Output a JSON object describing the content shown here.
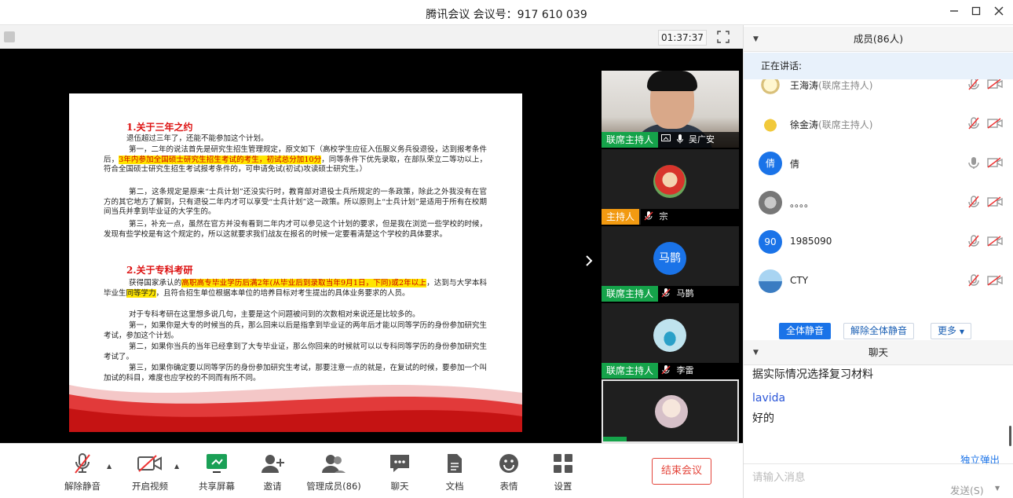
{
  "window": {
    "title": "腾讯会议 会议号：917 610 039",
    "controls": [
      "minimize-icon",
      "maximize-icon",
      "close-icon"
    ]
  },
  "stage": {
    "timer": "01:37:37",
    "slide": {
      "heading1": "1.关于三年之约",
      "p1": "退伍超过三年了，还能不能参加这个计划。",
      "p2a": "第一，二年的说法首先是研究生招生管理规定，原文如下（高校学生应征入伍服义务兵役退役，达到报考条件后，",
      "p2hl": "3年内参加全国硕士研究生招生考试的考生，初试总分加10分",
      "p2b": "，同等条件下优先录取，在部队荣立二等功以上，符合全国硕士研究生招生考试报考条件的，可申请免试(初试)攻读硕士研究生。）",
      "p3": "第二，这条规定是原来“士兵计划”还没实行时，教育部对退役士兵所规定的一条政策，除此之外我没有在官方的其它地方了解到，只有退役二年内才可以享受“士兵计划”这一政策。所以原则上“士兵计划”是适用于所有在校期间当兵并拿到毕业证的大学生的。",
      "p4": "第三，补充一点，虽然在官方并没有看到二年内才可以参见这个计划的要求，但是我在浏览一些学校的时候，发现有些学校是有这个规定的，所以这就要求我们战友在报名的时候一定要看清楚这个学校的具体要求。",
      "heading2": "2.关于专科考研",
      "p5a": "获得国家承认的",
      "p5hl": "高职高专毕业学历后满2年(从毕业后到录取当年9月1日，下同)或2年以上",
      "p5b": "，达到与大学本科毕业生",
      "p5hl2": "同等学力",
      "p5c": "，且符合招生单位根据本单位的培养目标对考生提出的具体业务要求的人员。",
      "p6": "对于专科考研在这里想多说几句，主要是这个问题被问到的次数相对来说还是比较多的。",
      "p7": "第一，如果你是大专的时候当的兵，那么回来以后是指拿到毕业证的两年后才能以同等学历的身份参加研究生考试，参加这个计划。",
      "p8": "第二，如果你当兵的当年已经拿到了大专毕业证，那么你回来的时候就可以以专科同等学历的身份参加研究生考试了。",
      "p9": "第三，如果你确定要以同等学历的身份参加研究生考试，那要注意一点的就是，在复试的时候，要参加一个叫加试的科目，难度也应学校的不同而有所不同。"
    },
    "videos": [
      {
        "role": "联席主持人",
        "name": "吴广安",
        "kind": "camera"
      },
      {
        "role": "主持人",
        "name": "宗",
        "kind": "avatar"
      },
      {
        "role": "联席主持人",
        "name": "马鹊",
        "kind": "initials",
        "initials": "马鹊"
      },
      {
        "role": "联席主持人",
        "name": "李雷",
        "kind": "avatar"
      },
      {
        "role": "",
        "name": "",
        "kind": "avatar"
      }
    ]
  },
  "toolbar": {
    "mute": "解除静音",
    "video": "开启视频",
    "share": "共享屏幕",
    "invite": "邀请",
    "manage": "管理成员(86)",
    "chat": "聊天",
    "docs": "文档",
    "emoji": "表情",
    "settings": "设置",
    "end": "结束会议"
  },
  "members": {
    "header": "成员(86人)",
    "speaking": "正在讲话:",
    "list": [
      {
        "name": "王海涛",
        "role": "(联席主持人)"
      },
      {
        "name": "徐金涛",
        "role": "(联席主持人)"
      },
      {
        "name": "倩",
        "role": "",
        "avatar": "倩"
      },
      {
        "name": "。。。。",
        "role": ""
      },
      {
        "name": "1985090",
        "role": "",
        "avatar": "90"
      },
      {
        "name": "CTY",
        "role": ""
      }
    ],
    "mute_all": "全体静音",
    "unmute_all": "解除全体静音",
    "more": "更多"
  },
  "chat": {
    "header": "聊天",
    "messages": [
      {
        "text": "据实际情况选择复习材料"
      },
      {
        "sender": "lavida"
      },
      {
        "text": "好的"
      }
    ],
    "popout": "独立弹出",
    "placeholder": "请输入消息",
    "send": "发送(S)"
  },
  "colors": {
    "accent": "#1a73e8",
    "host_badge": "#15a34a",
    "main_host_badge": "#f29a11",
    "end_red": "#e4443a"
  }
}
